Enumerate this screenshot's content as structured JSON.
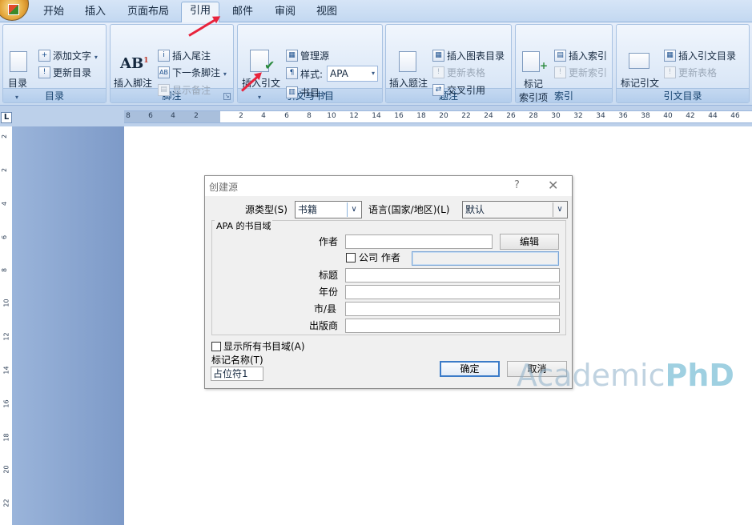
{
  "tabs": [
    {
      "label": "开始",
      "active": false
    },
    {
      "label": "插入",
      "active": false
    },
    {
      "label": "页面布局",
      "active": false
    },
    {
      "label": "引用",
      "active": true
    },
    {
      "label": "邮件",
      "active": false
    },
    {
      "label": "审阅",
      "active": false
    },
    {
      "label": "视图",
      "active": false
    }
  ],
  "ribbon": {
    "toc": {
      "label": "目录",
      "big_button": "目录",
      "add_text": "添加文字",
      "update_toc": "更新目录"
    },
    "footnotes": {
      "label": "脚注",
      "insert_footnote": "插入脚注",
      "insert_endnote": "插入尾注",
      "next_footnote": "下一条脚注",
      "show_notes": "显示备注"
    },
    "citations": {
      "label": "引文与书目",
      "insert_citation": "插入引文",
      "manage_sources": "管理源",
      "style_label": "样式:",
      "style_value": "APA",
      "bibliography": "书目"
    },
    "captions": {
      "label": "题注",
      "insert_caption": "插入题注",
      "insert_table_of_figures": "插入图表目录",
      "update_table": "更新表格",
      "cross_reference": "交叉引用"
    },
    "index": {
      "label": "索引",
      "mark_entry_line1": "标记",
      "mark_entry_line2": "索引项",
      "insert_index": "插入索引",
      "update_index": "更新索引"
    },
    "toa": {
      "label": "引文目录",
      "mark_citation": "标记引文",
      "insert_toa": "插入引文目录",
      "update_table": "更新表格"
    }
  },
  "ruler": {
    "h_ticks": [
      "8",
      "6",
      "4",
      "2",
      "2",
      "4",
      "6",
      "8",
      "10",
      "12",
      "14",
      "16",
      "18",
      "20",
      "22",
      "24",
      "26",
      "28",
      "30",
      "32",
      "34",
      "36",
      "38",
      "40",
      "42",
      "44",
      "46"
    ],
    "v_ticks": [
      "2",
      "2",
      "4",
      "6",
      "8",
      "10",
      "12",
      "14",
      "16",
      "18",
      "20",
      "22",
      "24"
    ]
  },
  "dialog": {
    "title": "创建源",
    "help": "?",
    "close": "✕",
    "source_type_label": "源类型(S)",
    "source_type_value": "书籍",
    "language_label": "语言(国家/地区)(L)",
    "language_value": "默认",
    "fieldset_label": "APA 的书目域",
    "fields": {
      "author": {
        "label": "作者",
        "value": ""
      },
      "corporate_label": "公司 作者",
      "title": {
        "label": "标题",
        "value": ""
      },
      "year": {
        "label": "年份",
        "value": ""
      },
      "city": {
        "label": "市/县",
        "value": ""
      },
      "publisher": {
        "label": "出版商",
        "value": ""
      }
    },
    "edit_button": "编辑",
    "show_all_label": "显示所有书目域(A)",
    "tag_name_label": "标记名称(T)",
    "tag_name_value": "占位符1",
    "ok_button": "确定",
    "cancel_button": "取消"
  },
  "watermark": {
    "part1": "Academic",
    "part2": "PhD"
  },
  "colors": {
    "accent_arrow": "#e8233c",
    "ribbon_blue": "#c9dbf1",
    "default_button_border": "#3b7bc8"
  }
}
